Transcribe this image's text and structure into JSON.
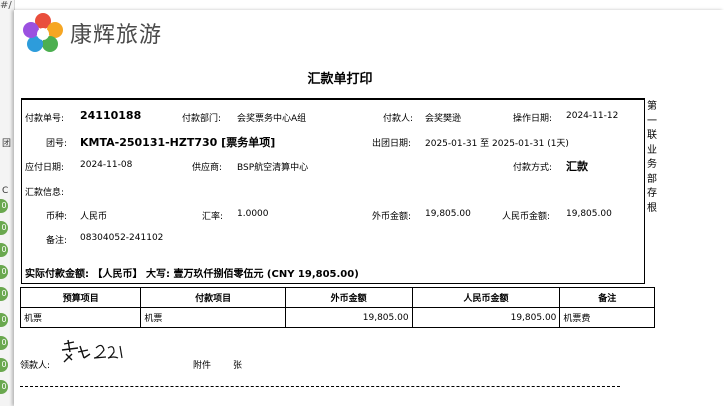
{
  "background": {
    "top_glyph": "#/",
    "left_label": "团",
    "left_label2": "C",
    "chip_label": "0"
  },
  "logo": {
    "text": "康辉旅游"
  },
  "title": "汇款单打印",
  "info": {
    "payment_no_label": "付款单号:",
    "payment_no": "24110188",
    "dept_label": "付款部门:",
    "dept": "会奖票务中心A组",
    "payer_label": "付款人:",
    "payer": "会奖樊逊",
    "op_date_label": "操作日期:",
    "op_date": "2024-11-12",
    "group_label": "团号:",
    "group": "KMTA-250131-HZT730 [票务单项]",
    "depart_label": "出团日期:",
    "depart": "2025-01-31 至 2025-01-31 (1天)",
    "due_label": "应付日期:",
    "due": "2024-11-08",
    "supplier_label": "供应商:",
    "supplier": "BSP航空清算中心",
    "method_label": "付款方式:",
    "method": "汇款",
    "remit_label": "汇款信息:",
    "currency_label": "币种:",
    "currency": "人民币",
    "rate_label": "汇率:",
    "rate": "1.0000",
    "foreign_label": "外币金额:",
    "foreign": "19,805.00",
    "rmb_label": "人民币金额:",
    "rmb": "19,805.00",
    "note_label": "备注:",
    "note": "08304052-241102",
    "actual": "实际付款金额: 【人民币】 大写: 壹万玖仟捌佰零伍元 (CNY 19,805.00)"
  },
  "side_text": [
    "第",
    "一",
    "联",
    "业",
    "务",
    "部",
    "存",
    "根"
  ],
  "table": {
    "headers": [
      "预算项目",
      "付款项目",
      "外币金额",
      "人民币金额",
      "备注"
    ],
    "rows": [
      [
        "机票",
        "机票",
        "19,805.00",
        "19,805.00",
        "机票费"
      ]
    ]
  },
  "footer": {
    "receiver_label": "领款人:",
    "attach_label": "附件",
    "attach_unit": "张"
  },
  "colors": {
    "logo_petals": [
      "#e94e3c",
      "#f6a623",
      "#4caf50",
      "#2d9cdb",
      "#9b51e0"
    ],
    "bg_chip": "#6aa84f"
  }
}
